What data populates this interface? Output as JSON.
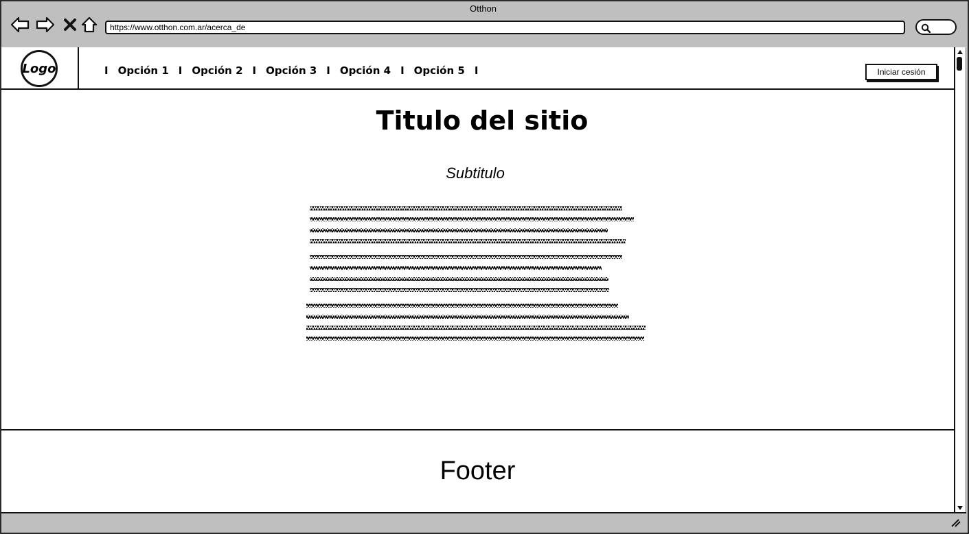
{
  "window": {
    "title": "Otthon"
  },
  "browser": {
    "url": "https://www.otthon.com.ar/acerca_de",
    "icons": [
      "back-arrow-icon",
      "forward-arrow-icon",
      "close-icon",
      "home-icon",
      "search-icon"
    ]
  },
  "header": {
    "logo": "Logo",
    "menu": [
      {
        "label": "Opción 1"
      },
      {
        "label": "Opción 2"
      },
      {
        "label": "Opción 3"
      },
      {
        "label": "Opción 4"
      },
      {
        "label": "Opción 5"
      }
    ],
    "separator": "I",
    "login_label": "Iniciar cesión"
  },
  "main": {
    "title": "Titulo del sitio",
    "subtitle": "Subtitulo"
  },
  "footer": {
    "label": "Footer"
  }
}
